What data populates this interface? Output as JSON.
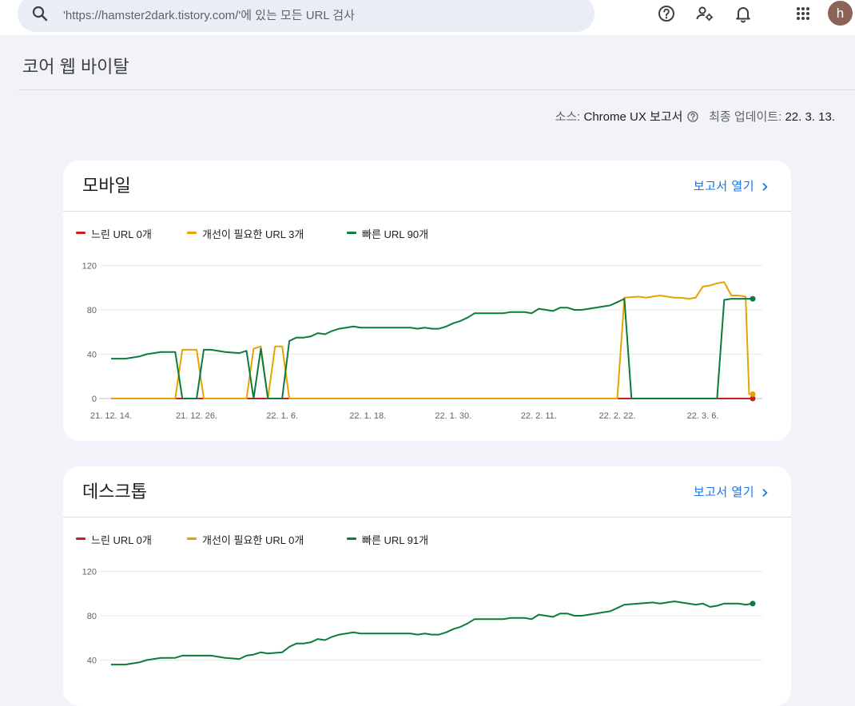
{
  "search": {
    "placeholder": "'https://hamster2dark.tistory.com/'에 있는 모든 URL 검사"
  },
  "header": {
    "avatar_letter": "h"
  },
  "page": {
    "title": "코어 웹 바이탈",
    "source_label": "소스: ",
    "source_value": "Chrome UX 보고서",
    "updated_label": "최종 업데이트: ",
    "updated_value": "22. 3. 13."
  },
  "colors": {
    "slow": "#c5221f",
    "needs_improvement": "#e8a200",
    "fast": "#0d7a3e",
    "link": "#1a73e8"
  },
  "icons": {
    "search": "search-icon",
    "help": "help-icon",
    "settings": "manage-accounts-icon",
    "notifications": "bell-icon",
    "apps": "apps-grid-icon",
    "chevron": "chevron-right-icon"
  },
  "cards": [
    {
      "title": "모바일",
      "open_label": "보고서 열기",
      "legend": [
        "느린 URL 0개",
        "개선이 필요한 URL 3개",
        "빠른 URL 90개"
      ]
    },
    {
      "title": "데스크톱",
      "open_label": "보고서 열기",
      "legend": [
        "느린 URL 0개",
        "개선이 필요한 URL 0개",
        "빠른 URL 91개"
      ]
    }
  ],
  "chart_data": [
    {
      "type": "line",
      "title": "모바일",
      "y_ticks": [
        0,
        40,
        80,
        120
      ],
      "ylim": [
        0,
        120
      ],
      "x_ticks": [
        {
          "day": 0,
          "label": "21. 12. 14."
        },
        {
          "day": 12,
          "label": "21. 12. 26."
        },
        {
          "day": 24,
          "label": "22. 1. 6."
        },
        {
          "day": 36,
          "label": "22. 1. 18."
        },
        {
          "day": 48,
          "label": "22. 1. 30."
        },
        {
          "day": 60,
          "label": "22. 2. 11."
        },
        {
          "day": 71,
          "label": "22. 2. 22."
        },
        {
          "day": 83,
          "label": "22. 3. 6."
        }
      ],
      "x_last_day": 90,
      "grid": true,
      "legend_position": "top-left",
      "series": [
        {
          "name": "느린 URL",
          "color": "#c5221f",
          "points": [
            [
              0,
              0
            ],
            [
              90,
              0
            ]
          ]
        },
        {
          "name": "개선이 필요한 URL",
          "color": "#e8a200",
          "points": [
            [
              0,
              0
            ],
            [
              9,
              0
            ],
            [
              10,
              44
            ],
            [
              12,
              44
            ],
            [
              13,
              0
            ],
            [
              19,
              0
            ],
            [
              20,
              45
            ],
            [
              21,
              47
            ],
            [
              22,
              0
            ],
            [
              23,
              47
            ],
            [
              24,
              47
            ],
            [
              25,
              0
            ],
            [
              71,
              0
            ],
            [
              72,
              91
            ],
            [
              74,
              92
            ],
            [
              75,
              91
            ],
            [
              76,
              92
            ],
            [
              77,
              93
            ],
            [
              78,
              92
            ],
            [
              79,
              91
            ],
            [
              80,
              91
            ],
            [
              81,
              90
            ],
            [
              82,
              91
            ],
            [
              83,
              101
            ],
            [
              84,
              102
            ],
            [
              85,
              104
            ],
            [
              86,
              105
            ],
            [
              87,
              93
            ],
            [
              88,
              93
            ],
            [
              89,
              92
            ],
            [
              89.5,
              4
            ],
            [
              90,
              4
            ]
          ]
        },
        {
          "name": "빠른 URL",
          "color": "#0d7a3e",
          "points": [
            [
              0,
              36
            ],
            [
              2,
              36
            ],
            [
              4,
              38
            ],
            [
              5,
              40
            ],
            [
              7,
              42
            ],
            [
              9,
              42
            ],
            [
              10,
              0
            ],
            [
              12,
              0
            ],
            [
              13,
              44
            ],
            [
              14,
              44
            ],
            [
              16,
              42
            ],
            [
              18,
              41
            ],
            [
              19,
              43
            ],
            [
              20,
              0
            ],
            [
              21,
              45
            ],
            [
              22,
              0
            ],
            [
              24,
              0
            ],
            [
              25,
              52
            ],
            [
              26,
              55
            ],
            [
              27,
              55
            ],
            [
              28,
              56
            ],
            [
              29,
              59
            ],
            [
              30,
              58
            ],
            [
              31,
              61
            ],
            [
              32,
              63
            ],
            [
              33,
              64
            ],
            [
              34,
              65
            ],
            [
              35,
              64
            ],
            [
              40,
              64
            ],
            [
              42,
              64
            ],
            [
              43,
              63
            ],
            [
              44,
              64
            ],
            [
              45,
              63
            ],
            [
              46,
              63
            ],
            [
              47,
              65
            ],
            [
              48,
              68
            ],
            [
              49,
              70
            ],
            [
              50,
              73
            ],
            [
              51,
              77
            ],
            [
              55,
              77
            ],
            [
              56,
              78
            ],
            [
              58,
              78
            ],
            [
              59,
              77
            ],
            [
              60,
              81
            ],
            [
              62,
              79
            ],
            [
              63,
              82
            ],
            [
              64,
              82
            ],
            [
              65,
              80
            ],
            [
              66,
              80
            ],
            [
              68,
              82
            ],
            [
              69,
              83
            ],
            [
              70,
              84
            ],
            [
              71,
              87
            ],
            [
              72,
              90
            ],
            [
              73,
              0
            ],
            [
              85,
              0
            ],
            [
              86,
              89
            ],
            [
              87,
              90
            ],
            [
              88,
              90
            ],
            [
              90,
              90
            ]
          ]
        }
      ]
    },
    {
      "type": "line",
      "title": "데스크톱",
      "y_ticks": [
        40,
        80,
        120
      ],
      "ylim": [
        0,
        120
      ],
      "x_last_day": 90,
      "grid": true,
      "legend_position": "top-left",
      "series": [
        {
          "name": "빠른 URL",
          "color": "#0d7a3e",
          "points": [
            [
              0,
              36
            ],
            [
              2,
              36
            ],
            [
              4,
              38
            ],
            [
              5,
              40
            ],
            [
              7,
              42
            ],
            [
              9,
              42
            ],
            [
              10,
              44
            ],
            [
              14,
              44
            ],
            [
              16,
              42
            ],
            [
              18,
              41
            ],
            [
              19,
              44
            ],
            [
              20,
              45
            ],
            [
              21,
              47
            ],
            [
              22,
              46
            ],
            [
              24,
              47
            ],
            [
              25,
              52
            ],
            [
              26,
              55
            ],
            [
              27,
              55
            ],
            [
              28,
              56
            ],
            [
              29,
              59
            ],
            [
              30,
              58
            ],
            [
              31,
              61
            ],
            [
              32,
              63
            ],
            [
              33,
              64
            ],
            [
              34,
              65
            ],
            [
              35,
              64
            ],
            [
              40,
              64
            ],
            [
              42,
              64
            ],
            [
              43,
              63
            ],
            [
              44,
              64
            ],
            [
              45,
              63
            ],
            [
              46,
              63
            ],
            [
              47,
              65
            ],
            [
              48,
              68
            ],
            [
              49,
              70
            ],
            [
              50,
              73
            ],
            [
              51,
              77
            ],
            [
              55,
              77
            ],
            [
              56,
              78
            ],
            [
              58,
              78
            ],
            [
              59,
              77
            ],
            [
              60,
              81
            ],
            [
              62,
              79
            ],
            [
              63,
              82
            ],
            [
              64,
              82
            ],
            [
              65,
              80
            ],
            [
              66,
              80
            ],
            [
              68,
              82
            ],
            [
              69,
              83
            ],
            [
              70,
              84
            ],
            [
              71,
              87
            ],
            [
              72,
              90
            ],
            [
              74,
              91
            ],
            [
              76,
              92
            ],
            [
              77,
              91
            ],
            [
              78,
              92
            ],
            [
              79,
              93
            ],
            [
              80,
              92
            ],
            [
              81,
              91
            ],
            [
              82,
              90
            ],
            [
              83,
              91
            ],
            [
              84,
              88
            ],
            [
              85,
              89
            ],
            [
              86,
              91
            ],
            [
              88,
              91
            ],
            [
              89,
              90
            ],
            [
              90,
              91
            ]
          ]
        }
      ]
    }
  ]
}
